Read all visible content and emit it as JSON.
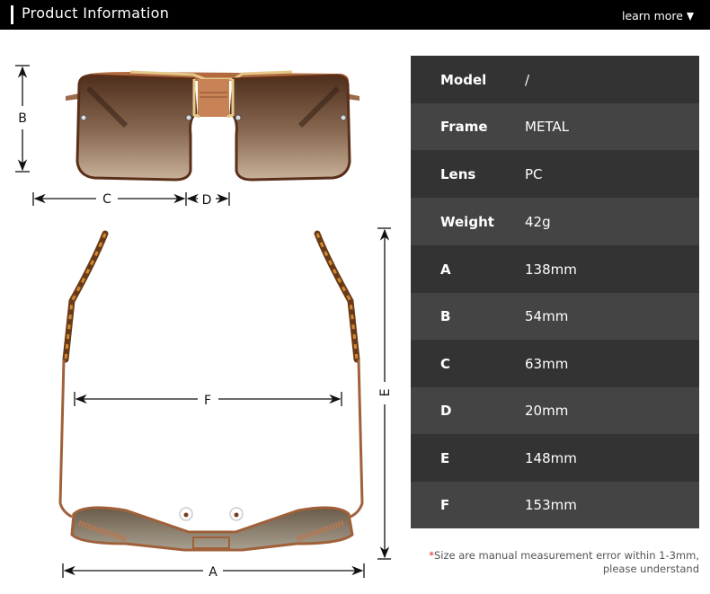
{
  "header": {
    "title": "Product Information",
    "learn_more": "learn more"
  },
  "specs": [
    {
      "label": "Model",
      "value": "/"
    },
    {
      "label": "Frame",
      "value": "METAL"
    },
    {
      "label": "Lens",
      "value": "PC"
    },
    {
      "label": "Weight",
      "value": "42g"
    },
    {
      "label": "A",
      "value": "138mm"
    },
    {
      "label": "B",
      "value": "54mm"
    },
    {
      "label": "C",
      "value": "63mm"
    },
    {
      "label": "D",
      "value": "20mm"
    },
    {
      "label": "E",
      "value": "148mm"
    },
    {
      "label": "F",
      "value": "153mm"
    }
  ],
  "note": {
    "asterisk": "*",
    "line1": "Size are manual measurement error within 1-3mm,",
    "line2": "please understand"
  },
  "diagram": {
    "labels": {
      "A": "A",
      "B": "B",
      "C": "C",
      "D": "D",
      "E": "E",
      "F": "F"
    }
  },
  "colors": {
    "header_bg": "#000000",
    "row_dark": "#333333",
    "row_light": "#444444",
    "frame_bronze": "#a0603a",
    "lens_brown": "#6b4a35",
    "accent_red": "#e02020"
  }
}
